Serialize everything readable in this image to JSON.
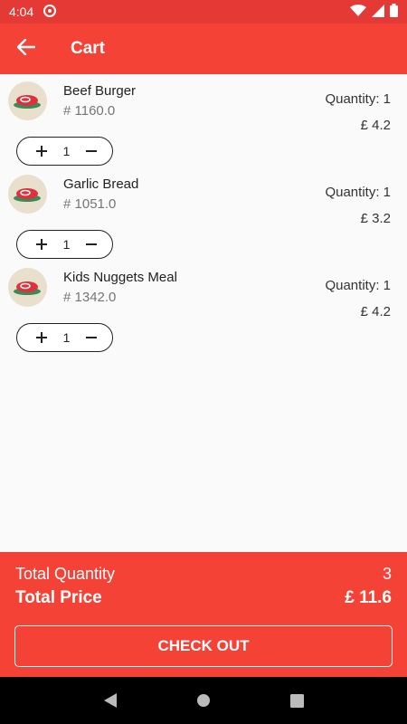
{
  "status_bar": {
    "time": "4:04"
  },
  "app_bar": {
    "title": "Cart"
  },
  "cart": {
    "items": [
      {
        "name": "Beef Burger",
        "code": "# 1160.0",
        "quantity_label": "Quantity: 1",
        "price": "£ 4.2",
        "count": "1"
      },
      {
        "name": "Garlic Bread",
        "code": "# 1051.0",
        "quantity_label": "Quantity: 1",
        "price": "£ 3.2",
        "count": "1"
      },
      {
        "name": "Kids Nuggets Meal",
        "code": "# 1342.0",
        "quantity_label": "Quantity: 1",
        "price": "£ 4.2",
        "count": "1"
      }
    ]
  },
  "summary": {
    "total_quantity_label": "Total Quantity",
    "total_quantity_value": "3",
    "total_price_label": "Total Price",
    "total_price_value": "£ 11.6",
    "checkout_label": "CHECK OUT"
  },
  "colors": {
    "primary": "#f44336",
    "status_bar": "#e53935",
    "nav_bar": "#000000"
  },
  "icons": [
    "back-arrow-icon",
    "wifi-icon",
    "battery-icon",
    "plus-icon",
    "minus-icon",
    "steak-icon",
    "nav-back-icon",
    "nav-home-icon",
    "nav-recents-icon"
  ]
}
